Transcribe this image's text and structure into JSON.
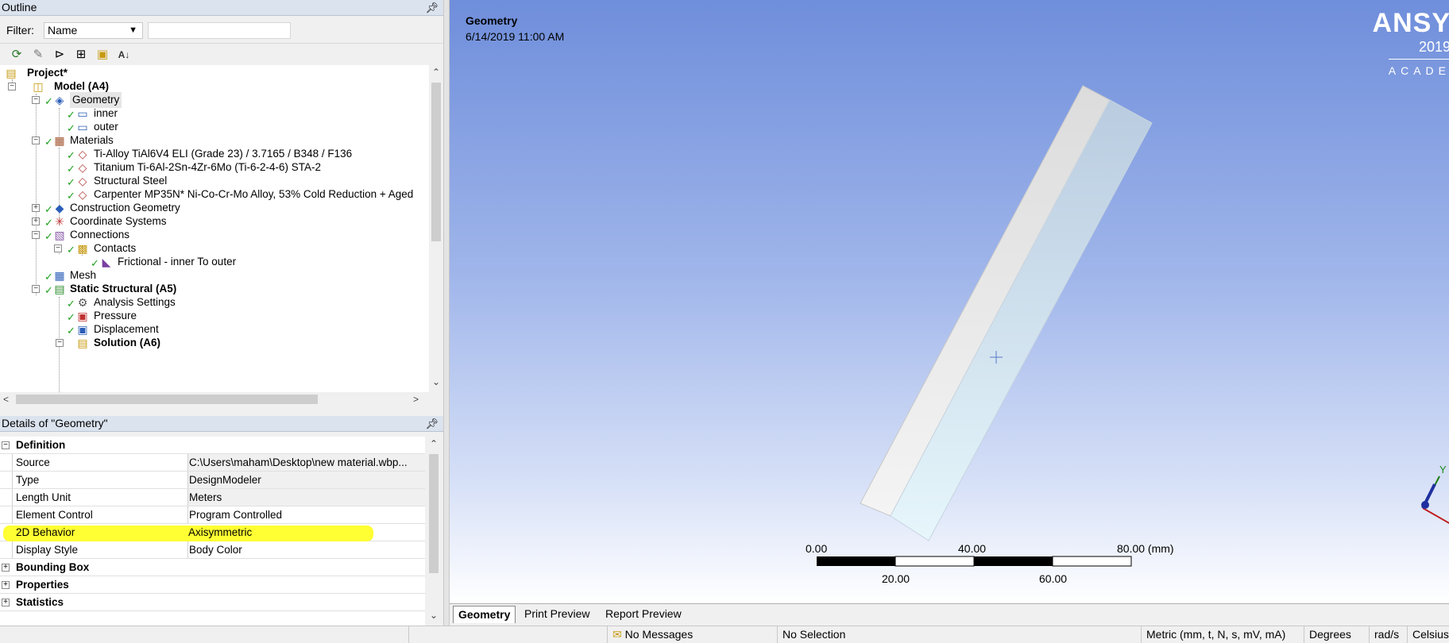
{
  "outline": {
    "title": "Outline",
    "filter_label": "Filter:",
    "filter_value": "Name",
    "tree": {
      "project": "Project*",
      "model": "Model (A4)",
      "geometry": "Geometry",
      "inner": "inner",
      "outer": "outer",
      "materials": "Materials",
      "mat1": "Ti-Alloy TiAl6V4 ELI (Grade 23) / 3.7165 / B348 / F136",
      "mat2": "Titanium Ti-6Al-2Sn-4Zr-6Mo (Ti-6-2-4-6) STA-2",
      "mat3": "Structural Steel",
      "mat4": "Carpenter MP35N* Ni-Co-Cr-Mo Alloy, 53% Cold Reduction + Aged",
      "construction_geometry": "Construction Geometry",
      "coordinate_systems": "Coordinate Systems",
      "connections": "Connections",
      "contacts": "Contacts",
      "contact1": "Frictional - inner To outer",
      "mesh": "Mesh",
      "static_structural": "Static Structural (A5)",
      "analysis_settings": "Analysis Settings",
      "pressure": "Pressure",
      "displacement": "Displacement",
      "solution": "Solution (A6)"
    }
  },
  "details": {
    "title": "Details of \"Geometry\"",
    "definition": "Definition",
    "rows": [
      {
        "name": "Source",
        "value": "C:\\Users\\maham\\Desktop\\new material.wbp..."
      },
      {
        "name": "Type",
        "value": "DesignModeler"
      },
      {
        "name": "Length Unit",
        "value": "Meters"
      },
      {
        "name": "Element Control",
        "value": "Program Controlled"
      },
      {
        "name": "2D Behavior",
        "value": "Axisymmetric"
      },
      {
        "name": "Display Style",
        "value": "Body Color"
      }
    ],
    "groups": [
      "Bounding Box",
      "Properties",
      "Statistics"
    ]
  },
  "viewport": {
    "title": "Geometry",
    "date": "6/14/2019 11:00 AM",
    "logo_text": "ANSY",
    "logo_year": "2019",
    "logo_sub": "ACADE",
    "scale": {
      "top_labels": [
        "0.00",
        "40.00",
        "80.00 (mm)"
      ],
      "bottom_labels": [
        "20.00",
        "60.00"
      ]
    },
    "triad_label": "Y",
    "tabs": [
      "Geometry",
      "Print Preview",
      "Report Preview"
    ]
  },
  "statusbar": {
    "messages": "No Messages",
    "selection": "No Selection",
    "units": "Metric (mm, t, N, s, mV, mA)",
    "angle": "Degrees",
    "rate": "rad/s",
    "temp": "Celsius"
  },
  "colors": {
    "highlight": "#ffff33",
    "check": "#1ea11e"
  }
}
